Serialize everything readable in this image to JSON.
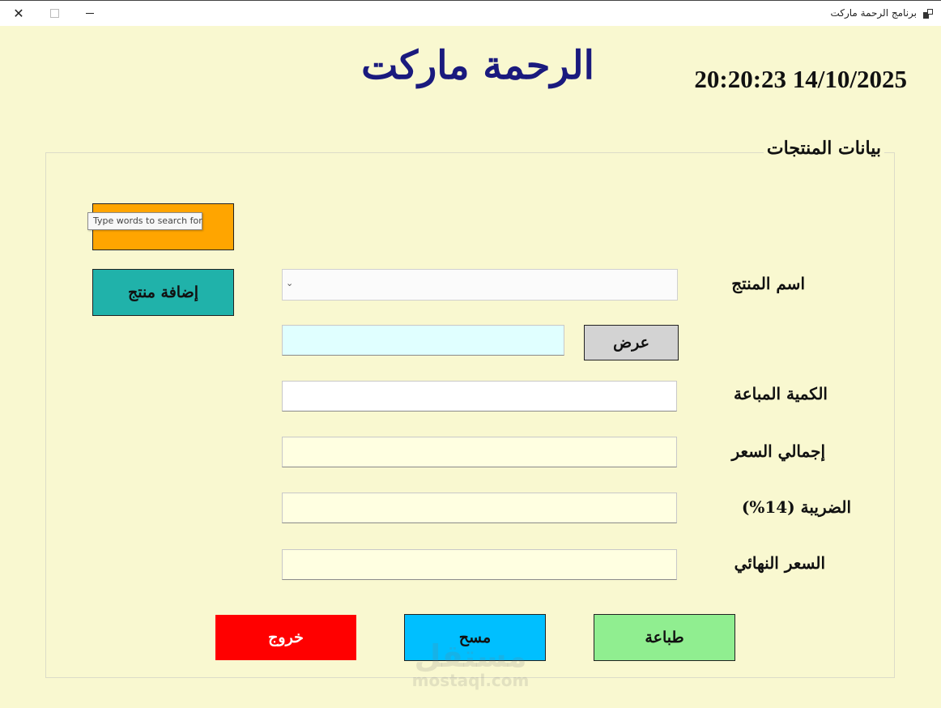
{
  "window": {
    "title": "برنامج الرحمة ماركت",
    "close_glyph": "✕"
  },
  "header": {
    "title": "الرحمة ماركت",
    "datetime": "20:20:23 14/10/2025"
  },
  "form": {
    "group_title": "بيانات المنتجات",
    "product_name_label": "اسم المنتج",
    "quantity_label": "الكمية المباعة",
    "total_price_label": "إجمالي السعر",
    "tax_label": "الضريبة (14%)",
    "final_price_label": "السعر النهائي",
    "product_name_value": "",
    "display_value": "",
    "quantity_value": "",
    "total_price_value": "",
    "tax_value": "",
    "final_price_value": ""
  },
  "buttons": {
    "display": "عرض",
    "add_product": "إضافة منتج",
    "orange": "",
    "print": "طباعة",
    "clear": "مسح",
    "exit": "خروج"
  },
  "tooltip": "Type words to search for",
  "watermark": {
    "arabic": "مستقل",
    "latin": "mostaql.com"
  },
  "colors": {
    "background": "#f9f8d0",
    "title": "#1a1a7e",
    "add_button": "#20b2aa",
    "orange_button": "#ffa500",
    "print_button": "#90ee90",
    "clear_button": "#00bfff",
    "exit_button": "#ff0000",
    "display_button": "#d3d3d3"
  },
  "icons": {
    "app": "app-window-icon",
    "close": "close-icon",
    "maximize": "maximize-icon",
    "minimize": "minimize-icon",
    "dropdown": "chevron-down-icon"
  }
}
